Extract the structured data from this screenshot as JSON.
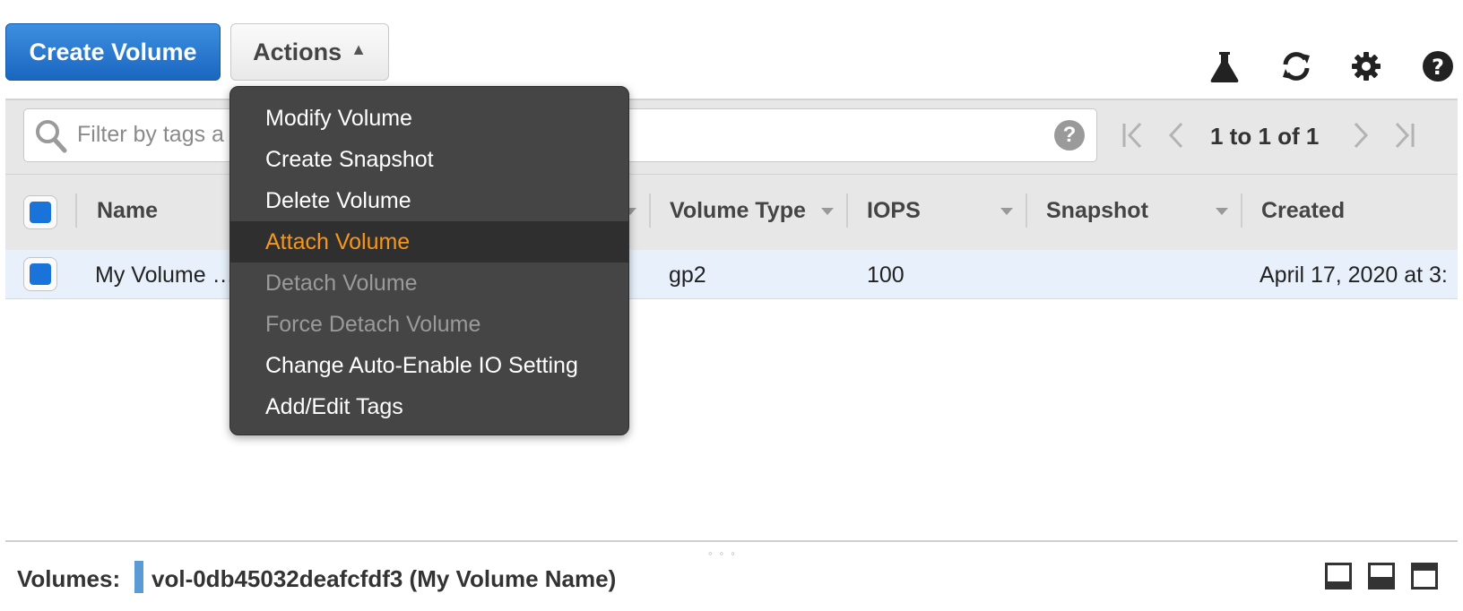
{
  "toolbar": {
    "create_label": "Create Volume",
    "actions_label": "Actions",
    "icons": [
      "flask-icon",
      "refresh-icon",
      "gear-icon",
      "help-icon"
    ]
  },
  "filter": {
    "placeholder": "Filter by tags a",
    "pagination": "1 to 1 of 1"
  },
  "table": {
    "columns": [
      "Name",
      "Volume Type",
      "IOPS",
      "Snapshot",
      "Created"
    ],
    "rows": [
      {
        "name": "My Volume …",
        "volume_type": "gp2",
        "iops": "100",
        "snapshot": "",
        "created": "April 17, 2020 at 3:"
      }
    ]
  },
  "menu": {
    "items": [
      {
        "label": "Modify Volume",
        "state": "enabled"
      },
      {
        "label": "Create Snapshot",
        "state": "enabled"
      },
      {
        "label": "Delete Volume",
        "state": "enabled"
      },
      {
        "label": "Attach Volume",
        "state": "highlighted"
      },
      {
        "label": "Detach Volume",
        "state": "disabled"
      },
      {
        "label": "Force Detach Volume",
        "state": "disabled"
      },
      {
        "label": "Change Auto-Enable IO Setting",
        "state": "enabled"
      },
      {
        "label": "Add/Edit Tags",
        "state": "enabled"
      }
    ]
  },
  "details": {
    "label": "Volumes:",
    "volume": "vol-0db45032deafcfdf3 (My Volume Name)"
  },
  "colors": {
    "primary": "#1a73d8",
    "menu_bg": "#454545",
    "menu_highlight": "#f7961c"
  }
}
